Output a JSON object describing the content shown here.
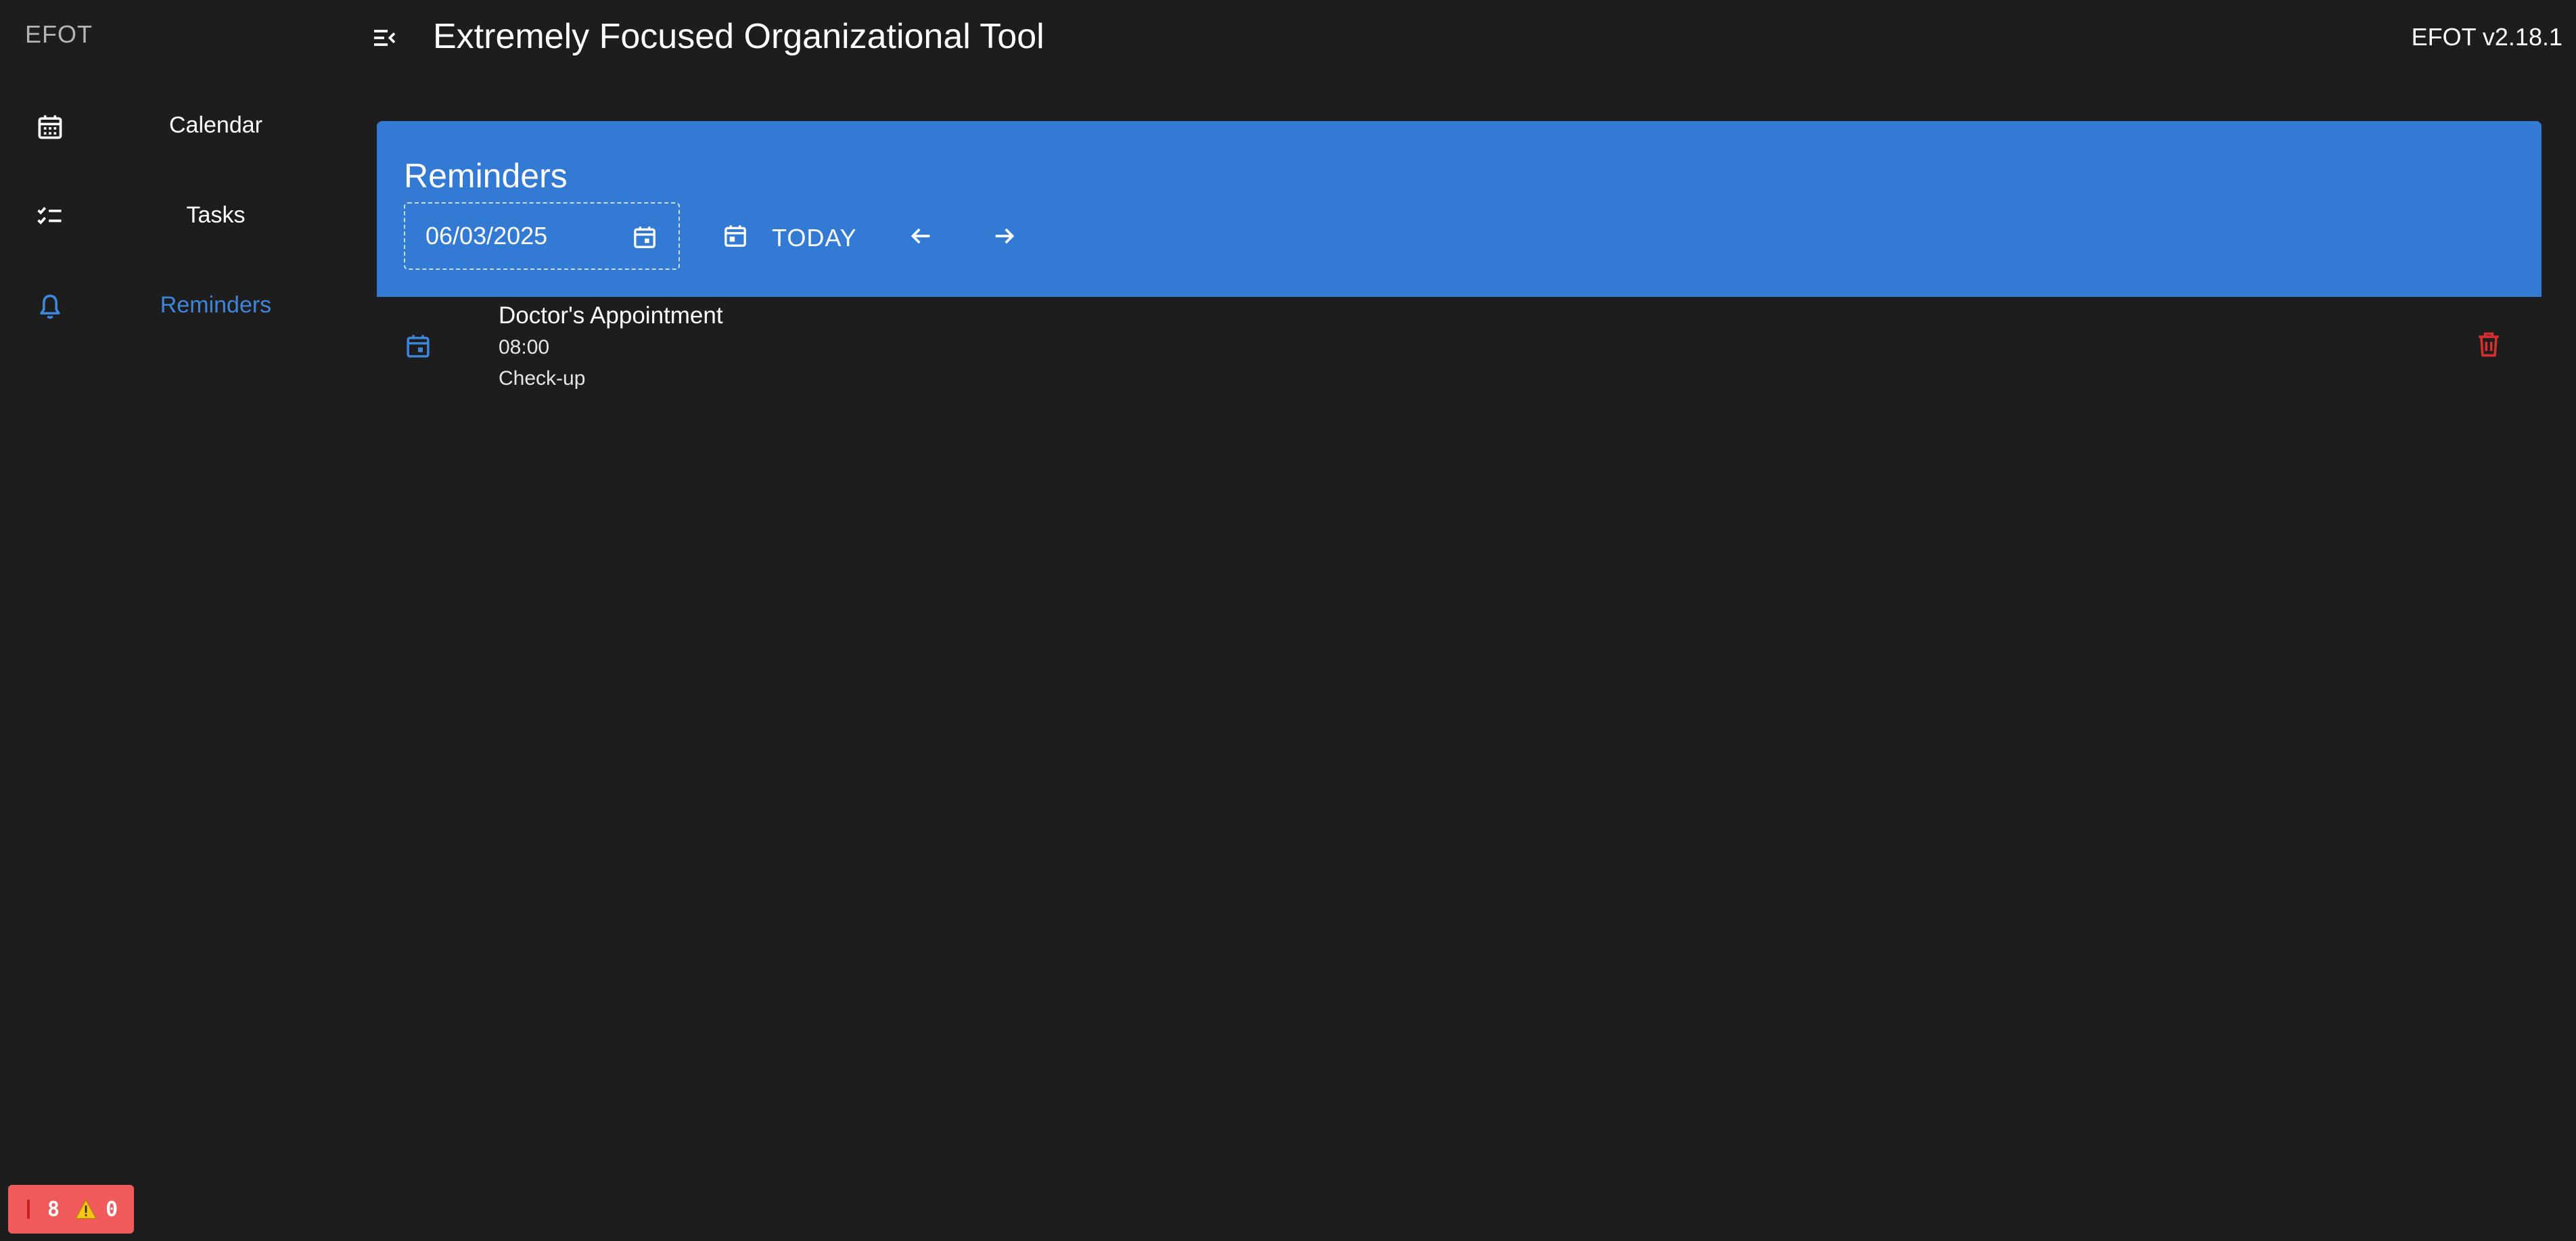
{
  "sidebar": {
    "brand": "EFOT",
    "items": [
      {
        "label": "Calendar",
        "icon": "calendar-icon",
        "active": false
      },
      {
        "label": "Tasks",
        "icon": "checklist-icon",
        "active": false
      },
      {
        "label": "Reminders",
        "icon": "bell-icon",
        "active": true
      }
    ]
  },
  "header": {
    "menu_icon": "menu-collapse-icon",
    "title": "Extremely Focused Organizational Tool",
    "version": "EFOT v2.18.1"
  },
  "reminders": {
    "title": "Reminders",
    "date_value": "06/03/2025",
    "today_label": "TODAY",
    "items": [
      {
        "title": "Doctor's Appointment",
        "time": "08:00",
        "description": "Check-up"
      }
    ]
  },
  "status": {
    "errors": "8",
    "warnings": "0"
  },
  "colors": {
    "background": "#1d1d1d",
    "accent": "#337ad5",
    "active_nav": "#3d86dc",
    "delete": "#d32f2f",
    "error_badge": "#f05a5a"
  }
}
